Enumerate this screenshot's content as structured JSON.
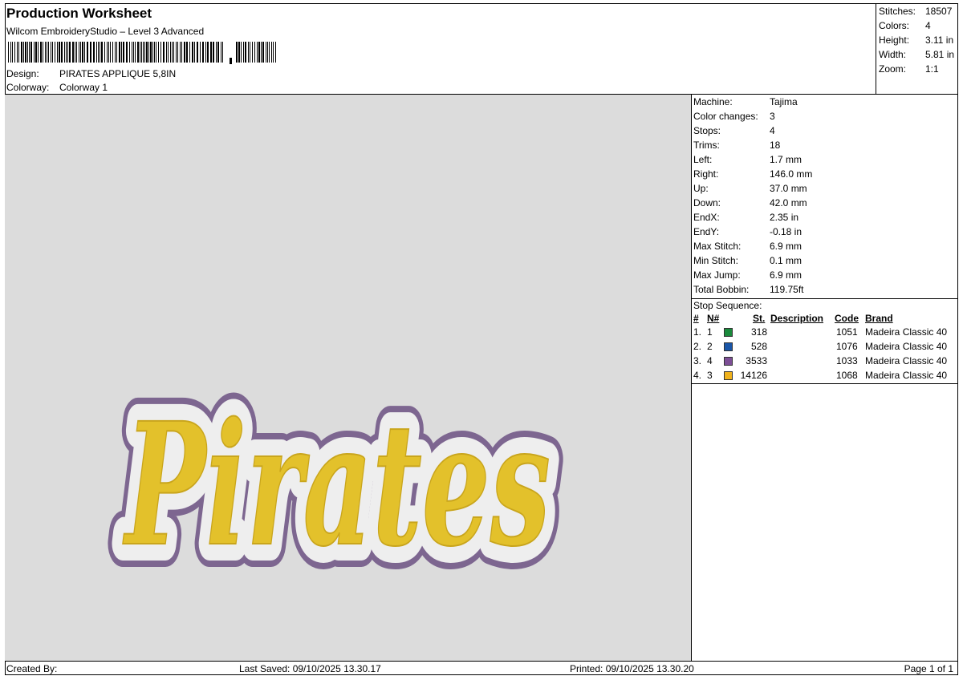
{
  "header": {
    "title": "Production Worksheet",
    "subtitle": "Wilcom EmbroideryStudio – Level 3 Advanced",
    "design_label": "Design:",
    "design_value": "PIRATES APPLIQUE 5,8IN",
    "colorway_label": "Colorway:",
    "colorway_value": "Colorway 1"
  },
  "stats": [
    {
      "label": "Stitches:",
      "value": "18507"
    },
    {
      "label": "Colors:",
      "value": "4"
    },
    {
      "label": "Height:",
      "value": "3.11 in"
    },
    {
      "label": "Width:",
      "value": "5.81 in"
    },
    {
      "label": "Zoom:",
      "value": "1:1"
    }
  ],
  "preview": {
    "word": "Pirates",
    "fill_color": "#e3c12b",
    "outline_color": "#7d6690",
    "border_color": "#eeeeee"
  },
  "machine": [
    {
      "label": "Machine:",
      "value": "Tajima"
    },
    {
      "label": "Color changes:",
      "value": "3"
    },
    {
      "label": "Stops:",
      "value": "4"
    },
    {
      "label": "Trims:",
      "value": "18"
    },
    {
      "label": "Left:",
      "value": "1.7 mm"
    },
    {
      "label": "Right:",
      "value": "146.0 mm"
    },
    {
      "label": "Up:",
      "value": "37.0 mm"
    },
    {
      "label": "Down:",
      "value": "42.0 mm"
    },
    {
      "label": "EndX:",
      "value": "2.35 in"
    },
    {
      "label": "EndY:",
      "value": "-0.18 in"
    },
    {
      "label": "Max Stitch:",
      "value": "6.9 mm"
    },
    {
      "label": "Min Stitch:",
      "value": "0.1 mm"
    },
    {
      "label": "Max Jump:",
      "value": "6.9 mm"
    },
    {
      "label": "Total Bobbin:",
      "value": "119.75ft"
    }
  ],
  "stop_sequence": {
    "title": "Stop Sequence:",
    "headers": {
      "num": "#",
      "n": "N#",
      "st": "St.",
      "desc": "Description",
      "code": "Code",
      "brand": "Brand"
    },
    "rows": [
      {
        "num": "1.",
        "n": "1",
        "color": "#1a8a3c",
        "st": "318",
        "desc": "",
        "code": "1051",
        "brand": "Madeira Classic 40"
      },
      {
        "num": "2.",
        "n": "2",
        "color": "#1a56a8",
        "st": "528",
        "desc": "",
        "code": "1076",
        "brand": "Madeira Classic 40"
      },
      {
        "num": "3.",
        "n": "4",
        "color": "#7d4f96",
        "st": "3533",
        "desc": "",
        "code": "1033",
        "brand": "Madeira Classic 40"
      },
      {
        "num": "4.",
        "n": "3",
        "color": "#f0b21c",
        "st": "14126",
        "desc": "",
        "code": "1068",
        "brand": "Madeira Classic 40"
      }
    ]
  },
  "footer": {
    "created_by": "Created By:",
    "last_saved": "Last Saved: 09/10/2025 13.30.17",
    "printed": "Printed: 09/10/2025 13.30.20",
    "page": "Page 1 of 1"
  }
}
